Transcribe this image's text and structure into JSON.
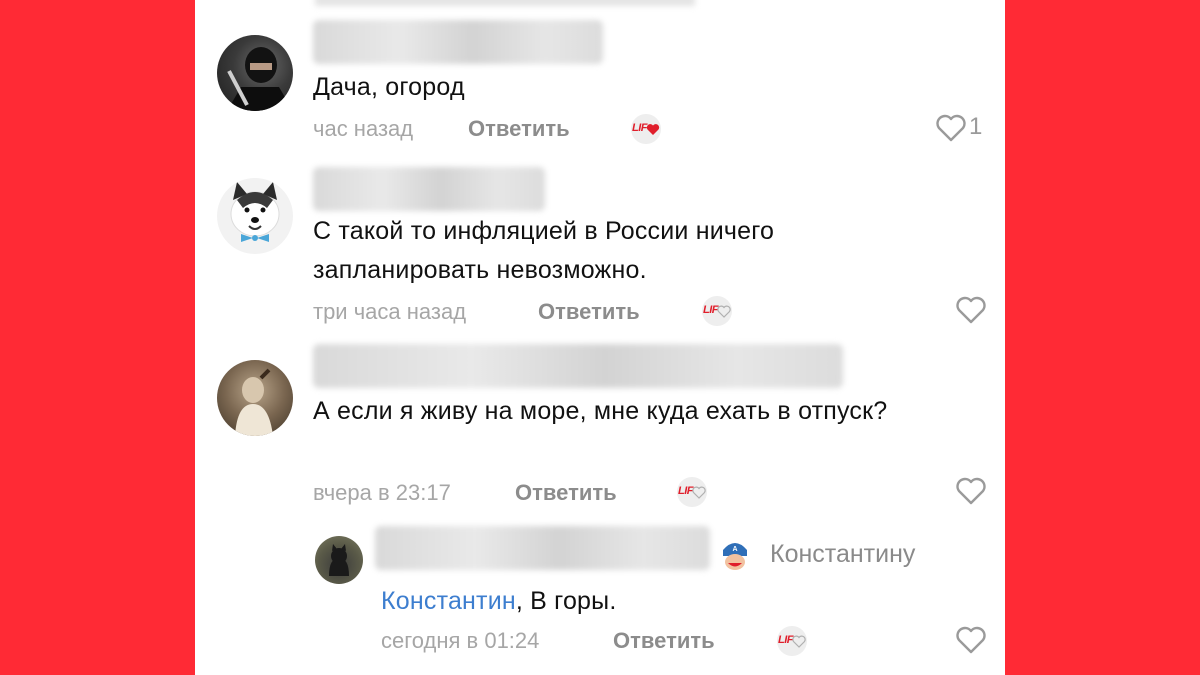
{
  "comments": [
    {
      "text": "Дача, огород",
      "time": "час назад",
      "reply_label": "Ответить",
      "lif_label": "LIF",
      "likes": "1",
      "liked_by_author": true
    },
    {
      "text": "С такой то инфляцией в России ничего запланировать невозможно.",
      "time": "три часа назад",
      "reply_label": "Ответить",
      "lif_label": "LIF",
      "likes": ""
    },
    {
      "text": "А если я живу на море, мне куда ехать в отпуск?",
      "time": "вчера в 23:17",
      "reply_label": "Ответить",
      "lif_label": "LIF",
      "likes": ""
    }
  ],
  "reply": {
    "reply_to": "Константину",
    "mention": "Константин",
    "text": ", В горы.",
    "time": "сегодня в 01:24",
    "reply_label": "Ответить",
    "lif_label": "LIF"
  },
  "colors": {
    "background": "#ff2a35",
    "panel": "#ffffff",
    "mention": "#3d7ecf",
    "lif_red": "#e01e2b"
  }
}
